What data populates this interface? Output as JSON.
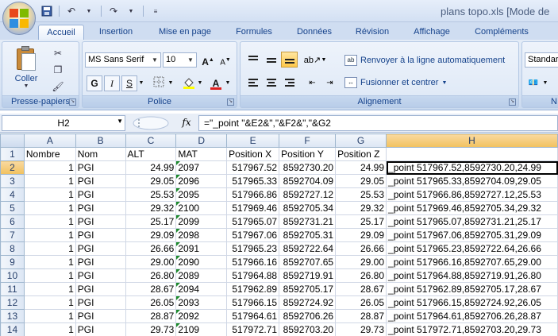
{
  "window": {
    "title": "plans topo.xls  [Mode de"
  },
  "tabs": [
    "Accueil",
    "Insertion",
    "Mise en page",
    "Formules",
    "Données",
    "Révision",
    "Affichage",
    "Compléments"
  ],
  "ribbon": {
    "clipboard": {
      "paste_label": "Coller",
      "group_label": "Presse-papiers"
    },
    "font": {
      "name": "MS Sans Serif",
      "size": "10",
      "group_label": "Police",
      "bold": "G",
      "italic": "I",
      "underline": "S"
    },
    "alignment": {
      "wrap_label": "Renvoyer à la ligne automatiquement",
      "merge_label": "Fusionner et centrer",
      "group_label": "Alignement"
    },
    "number": {
      "format": "Standar",
      "group_label": "N"
    }
  },
  "formula_bar": {
    "name_box": "H2",
    "fx": "fx",
    "formula": "=\"_point \"&E2&\",\"&F2&\",\"&G2"
  },
  "sheet": {
    "columns": [
      "A",
      "B",
      "C",
      "D",
      "E",
      "F",
      "G",
      "H"
    ],
    "rows": [
      [
        "1",
        "Nombre",
        "Nom",
        "ALT",
        "MAT",
        "Position X",
        "Position Y",
        "Position Z",
        ""
      ],
      [
        "2",
        "1",
        "PGI",
        "24.99",
        "2097",
        "517967.52",
        "8592730.20",
        "24.99",
        "_point 517967.52,8592730.20,24.99"
      ],
      [
        "3",
        "1",
        "PGI",
        "29.05",
        "2096",
        "517965.33",
        "8592704.09",
        "29.05",
        "_point 517965.33,8592704.09,29.05"
      ],
      [
        "4",
        "1",
        "PGI",
        "25.53",
        "2095",
        "517966.86",
        "8592727.12",
        "25.53",
        "_point 517966.86,8592727.12,25.53"
      ],
      [
        "5",
        "1",
        "PGI",
        "29.32",
        "2100",
        "517969.46",
        "8592705.34",
        "29.32",
        "_point 517969.46,8592705.34,29.32"
      ],
      [
        "6",
        "1",
        "PGI",
        "25.17",
        "2099",
        "517965.07",
        "8592731.21",
        "25.17",
        "_point 517965.07,8592731.21,25.17"
      ],
      [
        "7",
        "1",
        "PGI",
        "29.09",
        "2098",
        "517967.06",
        "8592705.31",
        "29.09",
        "_point 517967.06,8592705.31,29.09"
      ],
      [
        "8",
        "1",
        "PGI",
        "26.66",
        "2091",
        "517965.23",
        "8592722.64",
        "26.66",
        "_point 517965.23,8592722.64,26.66"
      ],
      [
        "9",
        "1",
        "PGI",
        "29.00",
        "2090",
        "517966.16",
        "8592707.65",
        "29.00",
        "_point 517966.16,8592707.65,29.00"
      ],
      [
        "10",
        "1",
        "PGI",
        "26.80",
        "2089",
        "517964.88",
        "8592719.91",
        "26.80",
        "_point 517964.88,8592719.91,26.80"
      ],
      [
        "11",
        "1",
        "PGI",
        "28.67",
        "2094",
        "517962.89",
        "8592705.17",
        "28.67",
        "_point 517962.89,8592705.17,28.67"
      ],
      [
        "12",
        "1",
        "PGI",
        "26.05",
        "2093",
        "517966.15",
        "8592724.92",
        "26.05",
        "_point 517966.15,8592724.92,26.05"
      ],
      [
        "13",
        "1",
        "PGI",
        "28.87",
        "2092",
        "517964.61",
        "8592706.26",
        "28.87",
        "_point 517964.61,8592706.26,28.87"
      ],
      [
        "14",
        "1",
        "PGI",
        "29.73",
        "2109",
        "517972.71",
        "8592703.20",
        "29.73",
        "_point 517972.71,8592703.20,29.73"
      ]
    ]
  }
}
